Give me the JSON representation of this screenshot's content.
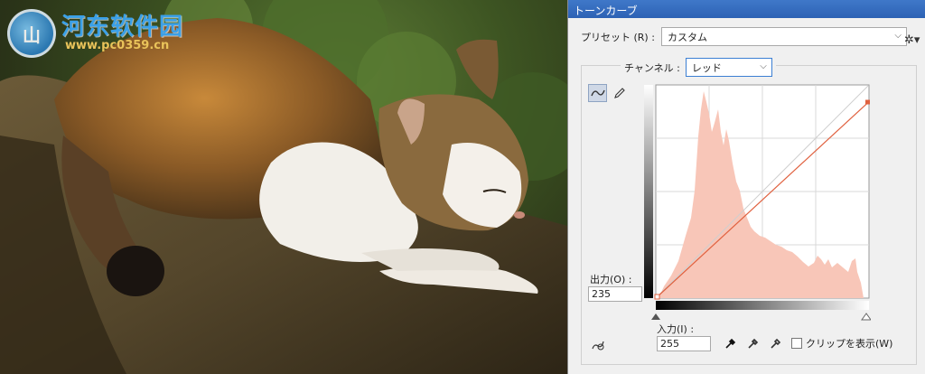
{
  "watermark": {
    "logo_glyph": "山",
    "title": "河东软件园",
    "url": "www.pc0359.cn"
  },
  "dialog": {
    "title": "トーンカーブ",
    "preset": {
      "label": "プリセット (R) :",
      "value": "カスタム"
    },
    "channel": {
      "label": "チャンネル :",
      "value": "レッド"
    },
    "output": {
      "label": "出力(O) :",
      "value": "235"
    },
    "input": {
      "label": "入力(I) :",
      "value": "255"
    },
    "clipping": {
      "label": "クリップを表示(W)",
      "checked": false
    }
  },
  "icons": {
    "gear": "gear-icon",
    "curve_tool": "curve-tool-icon",
    "pencil_tool": "pencil-icon",
    "eyedroppers": [
      "black-eyedropper-icon",
      "gray-eyedropper-icon",
      "white-eyedropper-icon"
    ],
    "auto": "on-image-adjust-icon",
    "chevron": "chevron-down-icon"
  },
  "colors": {
    "accent": "#3c7fd3",
    "histogram": "#f8c6b8",
    "curve": "#e0613f",
    "title_bar": "#2d62b4"
  },
  "curve": {
    "points": [
      [
        0,
        0
      ],
      [
        255,
        235
      ]
    ],
    "range": [
      0,
      255
    ]
  }
}
